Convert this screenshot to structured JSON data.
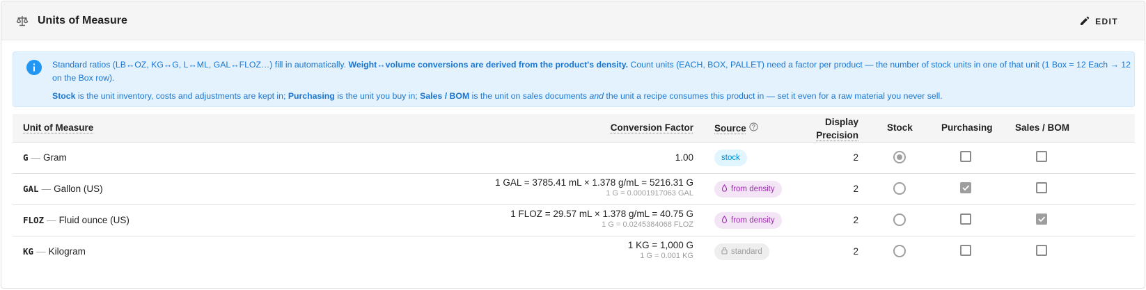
{
  "header": {
    "title": "Units of Measure",
    "edit_label": "EDIT"
  },
  "info": {
    "p1_a": "Standard ratios (LB↔OZ, KG↔G, L↔ML, GAL↔FLOZ…) fill in automatically. ",
    "p1_b": "Weight↔volume conversions are derived from the product's density.",
    "p1_c": " Count units (EACH, BOX, PALLET) need a factor per product — the number of stock units in one of that unit (1 Box = 12 Each → 12 on the Box row).",
    "p2_stock": "Stock",
    "p2_a": " is the unit inventory, costs and adjustments are kept in; ",
    "p2_purch": "Purchasing",
    "p2_b": " is the unit you buy in; ",
    "p2_sales": "Sales / BOM",
    "p2_c": " is the unit on sales documents ",
    "p2_and": "and",
    "p2_d": " the unit a recipe consumes this product in — set it even for a raw material you never sell."
  },
  "columns": {
    "uom": "Unit of Measure",
    "factor": "Conversion Factor",
    "source": "Source",
    "precision_1": "Display",
    "precision_2": "Precision",
    "stock": "Stock",
    "purchasing": "Purchasing",
    "sales": "Sales / BOM"
  },
  "rows": [
    {
      "code": "G",
      "name": "Gram",
      "factor": "1.00",
      "factor_sub": "",
      "source": "stock",
      "precision": "2",
      "stock": true,
      "purchasing": false,
      "sales": false
    },
    {
      "code": "GAL",
      "name": "Gallon (US)",
      "factor": "1 GAL = 3785.41 mL × 1.378 g/mL = 5216.31 G",
      "factor_sub": "1 G = 0.0001917063 GAL",
      "source": "from density",
      "precision": "2",
      "stock": false,
      "purchasing": true,
      "sales": false
    },
    {
      "code": "FLOZ",
      "name": "Fluid ounce (US)",
      "factor": "1 FLOZ = 29.57 mL × 1.378 g/mL = 40.75 G",
      "factor_sub": "1 G = 0.0245384068 FLOZ",
      "source": "from density",
      "precision": "2",
      "stock": false,
      "purchasing": false,
      "sales": true
    },
    {
      "code": "KG",
      "name": "Kilogram",
      "factor": "1 KG = 1,000 G",
      "factor_sub": "1 G = 0.001 KG",
      "source": "standard",
      "precision": "2",
      "stock": false,
      "purchasing": false,
      "sales": false
    }
  ],
  "colors": {
    "info_bg": "#e3f2fd",
    "info_text": "#1976d2",
    "chip_stock": "#0288d1",
    "chip_density": "#9c27b0",
    "chip_standard": "#9e9e9e"
  }
}
